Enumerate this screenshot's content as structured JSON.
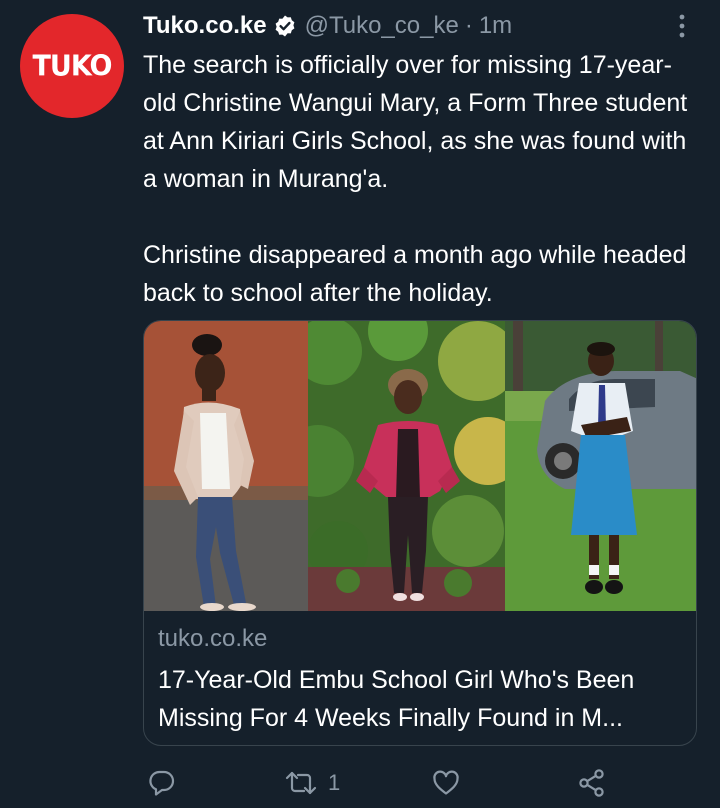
{
  "author": {
    "logo_text": "TUKO",
    "name": "Tuko.co.ke",
    "handle": "@Tuko_co_ke",
    "separator": "·",
    "time": "1m"
  },
  "tweet": {
    "paragraphs": [
      "The search is officially over for missing 17-year-old Christine Wangui Mary, a Form Three student at Ann Kiriari Girls School, as she was found with a woman in Murang'a.",
      "Christine disappeared a month ago while headed back to school after the holiday."
    ]
  },
  "card": {
    "domain": "tuko.co.ke",
    "title": "17-Year-Old Embu School Girl Who's Been\nMissing For 4 Weeks Finally Found in M..."
  },
  "actions": {
    "reply_count": "",
    "retweet_count": "1",
    "like_count": ""
  },
  "colors": {
    "background": "#15202b",
    "text_primary": "#ffffff",
    "text_secondary": "#8b98a5",
    "brand_red": "#e3272b",
    "verified_blue": "#ffffff",
    "card_border": "#38444d"
  },
  "icons": [
    "verified-badge-icon",
    "more-options-icon",
    "reply-icon",
    "retweet-icon",
    "like-icon",
    "share-icon"
  ]
}
